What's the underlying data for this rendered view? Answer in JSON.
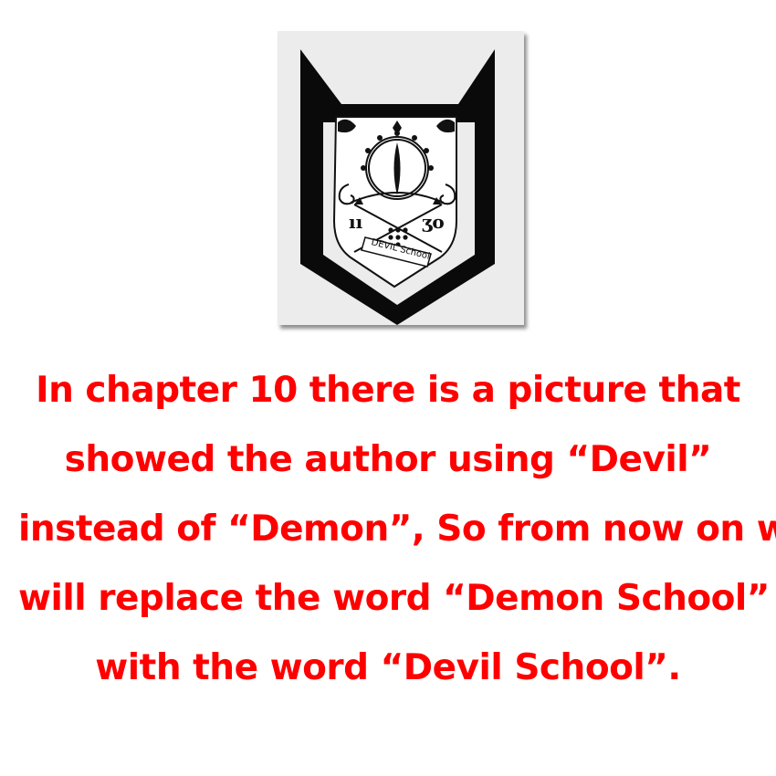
{
  "emblem": {
    "icon": "devil-school-crest-icon",
    "banner_text": "DEVIL School",
    "left_symbol": "ıı",
    "right_symbol": "ʒo"
  },
  "notice": {
    "color": "#ff0000",
    "lines": [
      "In chapter 10 there is a picture that",
      "showed the author using “Devil”",
      "instead of “Demon”, So from now on we",
      "will replace the word “Demon School”",
      "with the word “Devil School”."
    ]
  }
}
